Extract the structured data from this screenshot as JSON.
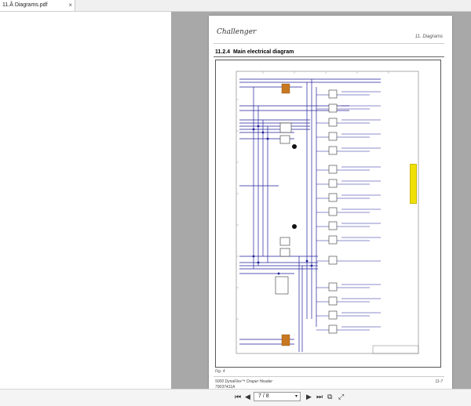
{
  "tab": {
    "title": "11.Â Diagrams.pdf",
    "close": "×"
  },
  "page": {
    "logo": "Challenger",
    "chapter": "11. Diagrams",
    "section_number": "11.2.4",
    "section_title": "Main electrical diagram",
    "figure": "Fig. 4",
    "footer_line1": "5000 DynaFlex™ Draper Header",
    "footer_line2": "79037411A",
    "page_number": "11-7"
  },
  "toolbar": {
    "first": "⏮",
    "prev": "◀",
    "page_display": "7 / 8",
    "dropdown": "▾",
    "next": "▶",
    "last": "⏭",
    "copy": "⧉",
    "fit": "⤢"
  },
  "colors": {
    "wire": "#1f1f9a",
    "connector": "#c87820",
    "marker": "#f0e000"
  },
  "icons": [
    "close-icon",
    "first-page-icon",
    "prev-page-icon",
    "next-page-icon",
    "last-page-icon",
    "copy-icon",
    "fit-page-icon"
  ]
}
